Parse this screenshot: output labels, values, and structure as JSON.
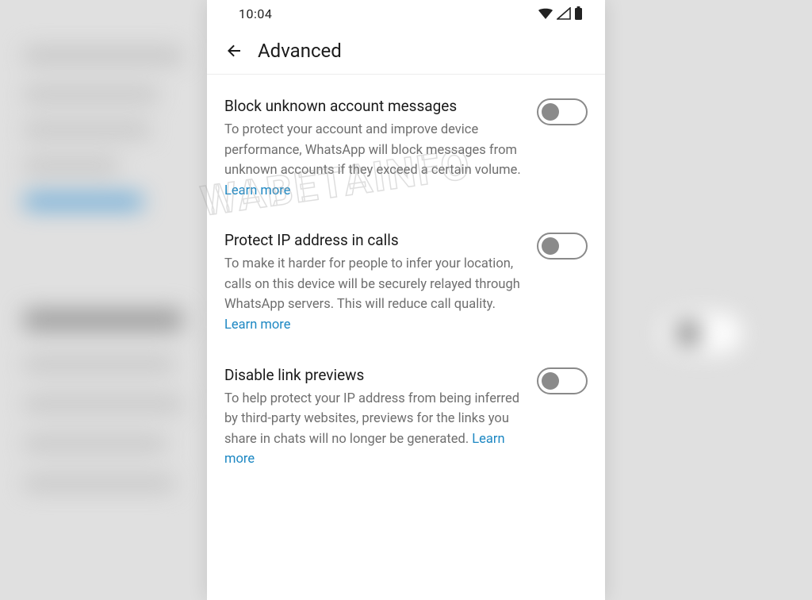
{
  "status_bar": {
    "time": "10:04"
  },
  "header": {
    "title": "Advanced"
  },
  "settings": [
    {
      "title": "Block unknown account messages",
      "description": "To protect your account and improve device performance, WhatsApp will block messages from unknown accounts if they exceed a certain volume. ",
      "learn_more": "Learn more",
      "enabled": false
    },
    {
      "title": "Protect IP address in calls",
      "description": "To make it harder for people to infer your location, calls on this device will be securely relayed through WhatsApp servers. This will reduce call quality. ",
      "learn_more": "Learn more",
      "enabled": false
    },
    {
      "title": "Disable link previews",
      "description": "To help protect your IP address from being inferred by third-party websites, previews for the links you share in chats will no longer be generated. ",
      "learn_more": "Learn more",
      "enabled": false
    }
  ],
  "watermark": "WABETAINFO"
}
